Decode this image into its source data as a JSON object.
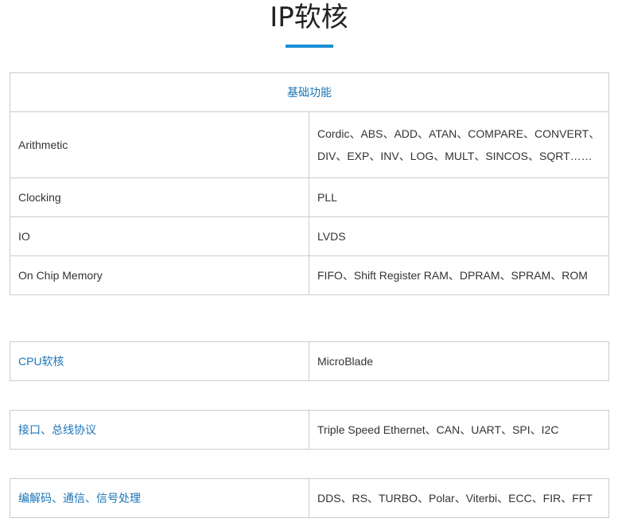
{
  "page": {
    "title": "IP软核"
  },
  "basic_functions": {
    "header": "基础功能",
    "rows": [
      {
        "name": "Arithmetic",
        "value": "Cordic、ABS、ADD、ATAN、COMPARE、CONVERT、DIV、EXP、INV、LOG、MULT、SINCOS、SQRT……"
      },
      {
        "name": "Clocking",
        "value": "PLL"
      },
      {
        "name": "IO",
        "value": "LVDS"
      },
      {
        "name": "On Chip Memory",
        "value": "FIFO、Shift Register RAM、DPRAM、SPRAM、ROM"
      }
    ]
  },
  "cpu_core": {
    "name": "CPU软核",
    "value": "MicroBlade"
  },
  "interface": {
    "name": "接口、总线协议",
    "value": "Triple Speed Ethernet、CAN、UART、SPI、I2C"
  },
  "codec": {
    "name": "编解码、通信、信号处理",
    "value": "DDS、RS、TURBO、Polar、Viterbi、ECC、FIR、FFT"
  },
  "colors": {
    "accent": "#1b8fd6",
    "link_text": "#1b75b8",
    "border": "#cccccc"
  }
}
